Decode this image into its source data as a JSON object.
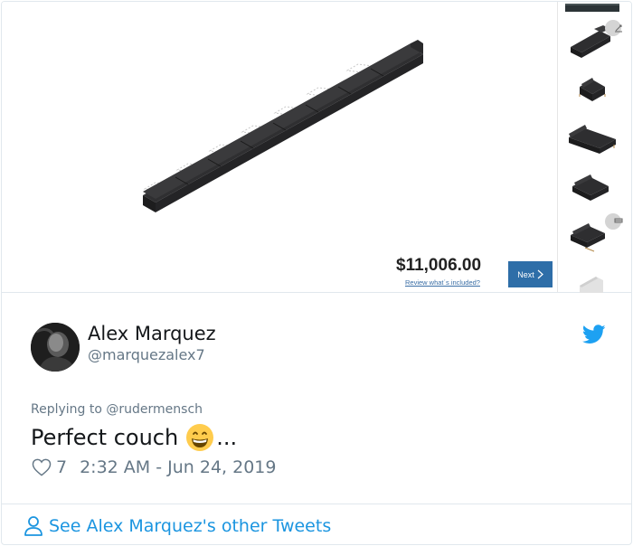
{
  "configurator": {
    "price": "$11,006.00",
    "review_link": "Review what´s included?",
    "next_label": "Next",
    "thumbnails": [
      "sofa-module-1",
      "sofa-module-2",
      "sofa-module-3",
      "sofa-module-4",
      "sofa-module-5",
      "sofa-module-6"
    ]
  },
  "tweet": {
    "display_name": "Alex Marquez",
    "handle": "@marquezalex7",
    "reply_prefix": "Replying to ",
    "reply_to": "@rudermensch",
    "text": "Perfect couch",
    "text_suffix": "...",
    "likes": "7",
    "timestamp": "2:32 AM - Jun 24, 2019",
    "footer_link": "See Alex Marquez's other Tweets",
    "colors": {
      "link": "#1b95e0",
      "twitter_blue": "#1da1f2",
      "muted": "#657786"
    }
  }
}
